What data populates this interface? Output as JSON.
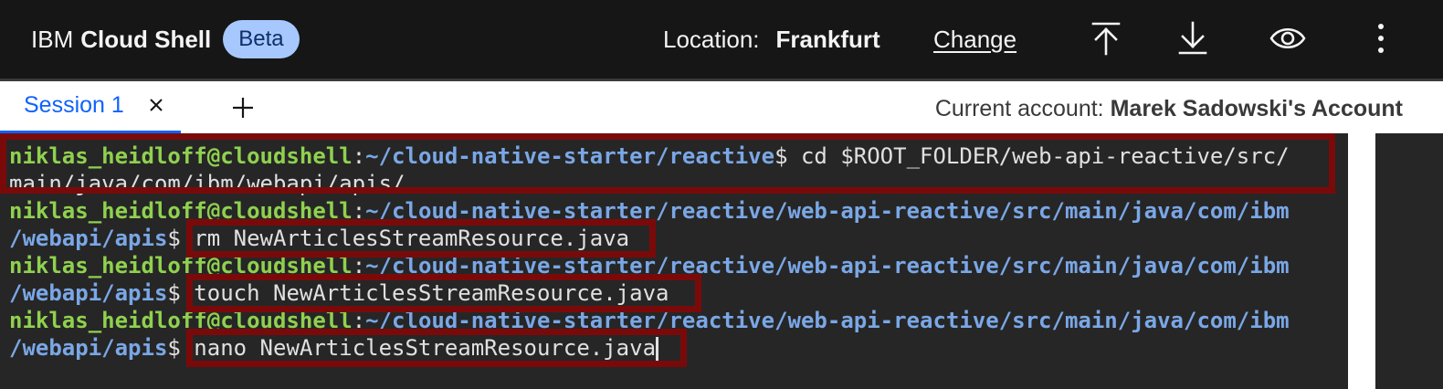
{
  "header": {
    "brand_prefix": "IBM",
    "brand_product": "Cloud Shell",
    "badge": "Beta",
    "location_label": "Location:",
    "location_value": "Frankfurt",
    "change_link": "Change",
    "icons": [
      "upload-icon",
      "download-icon",
      "eye-icon",
      "overflow-menu-icon"
    ]
  },
  "tabs": {
    "active_label": "Session 1",
    "close_glyph": "×",
    "add_glyph": "+"
  },
  "account": {
    "label": "Current account:",
    "value": "Marek Sadowski's Account"
  },
  "terminal": {
    "lines": [
      {
        "user": "niklas_heidloff@cloudshell",
        "sep": ":",
        "path": "~/cloud-native-starter/reactive",
        "prompt": "$ ",
        "cmd": "cd $ROOT_FOLDER/web-api-reactive/src/"
      },
      {
        "text": "main/java/com/ibm/webapi/apis/"
      },
      {
        "user": "niklas_heidloff@cloudshell",
        "sep": ":",
        "path": "~/cloud-native-starter/reactive/web-api-reactive/src/main/java/com/ibm"
      },
      {
        "path": "/webapi/apis",
        "prompt": "$ ",
        "cmd": "rm NewArticlesStreamResource.java"
      },
      {
        "user": "niklas_heidloff@cloudshell",
        "sep": ":",
        "path": "~/cloud-native-starter/reactive/web-api-reactive/src/main/java/com/ibm"
      },
      {
        "path": "/webapi/apis",
        "prompt": "$ ",
        "cmd": "touch NewArticlesStreamResource.java"
      },
      {
        "user": "niklas_heidloff@cloudshell",
        "sep": ":",
        "path": "~/cloud-native-starter/reactive/web-api-reactive/src/main/java/com/ibm"
      },
      {
        "path": "/webapi/apis",
        "prompt": "$ ",
        "cmd": "nano NewArticlesStreamResource.java"
      }
    ]
  },
  "colors": {
    "accent": "#0f62fe",
    "badge_bg": "#a6c8ff",
    "highlight": "#7a0a0a",
    "terminal_user": "#8fd14f",
    "terminal_path": "#7aa7e6"
  }
}
